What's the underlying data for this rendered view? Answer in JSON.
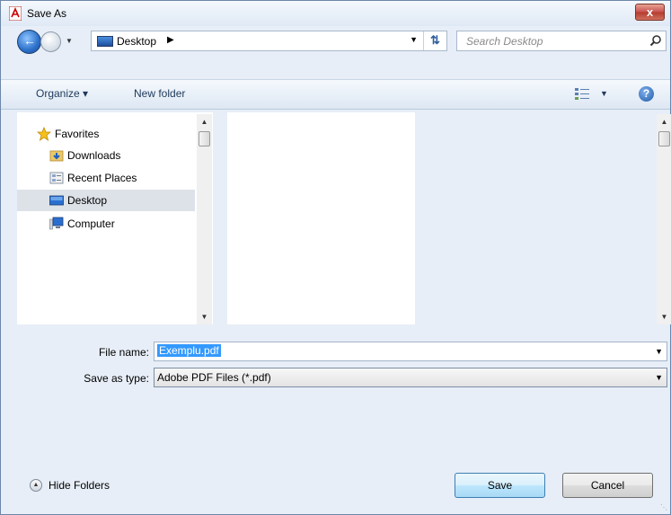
{
  "window": {
    "title": "Save As",
    "close_label": "x"
  },
  "nav": {
    "address": "Desktop",
    "search_placeholder": "Search Desktop"
  },
  "toolbar": {
    "organize_label": "Organize ▾",
    "new_folder_label": "New folder",
    "help_label": "?"
  },
  "sidebar": {
    "items": [
      {
        "label": "Favorites",
        "icon": "star-icon"
      },
      {
        "label": "Downloads",
        "icon": "downloads-folder-icon"
      },
      {
        "label": "Recent Places",
        "icon": "recent-places-icon"
      },
      {
        "label": "Desktop",
        "icon": "desktop-icon",
        "selected": true
      },
      {
        "label": "Computer",
        "icon": "computer-icon"
      }
    ]
  },
  "form": {
    "filename_label": "File name:",
    "filename_value": "Exemplu.pdf",
    "type_label": "Save as type:",
    "type_value": "Adobe PDF Files (*.pdf)"
  },
  "footer": {
    "hide_folders_label": "Hide Folders",
    "save_label": "Save",
    "cancel_label": "Cancel"
  },
  "colors": {
    "selection": "#3399ff",
    "window_bg": "#e7eef7"
  }
}
